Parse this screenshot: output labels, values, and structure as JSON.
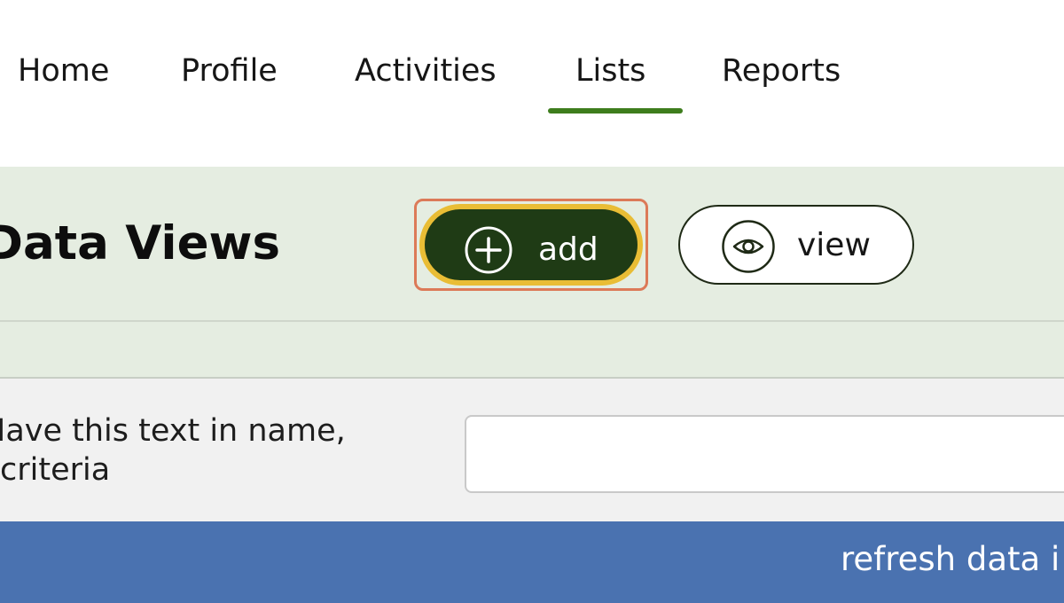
{
  "nav": {
    "tabs": [
      {
        "label": "Home"
      },
      {
        "label": "Profile"
      },
      {
        "label": "Activities"
      },
      {
        "label": "Lists",
        "active": true
      },
      {
        "label": "Reports"
      }
    ],
    "active_tab": "Lists",
    "active_color": "#3e7d1d"
  },
  "header": {
    "title": "Data Views",
    "add_label": "add",
    "view_label": "view"
  },
  "filter": {
    "label_line1": "Have this text in name,",
    "label_line2": "criteria",
    "value": "",
    "placeholder": ""
  },
  "footer_bar": {
    "refresh_label": "refresh data i"
  },
  "colors": {
    "add_button_bg": "#1f3b15",
    "add_button_ring": "#e9bd35",
    "highlight_border": "#dc7a58",
    "header_band": "#e5ede1",
    "blue_bar": "#4a72b0"
  },
  "icons": {
    "add": "plus-circle-icon",
    "view": "eye-icon"
  }
}
